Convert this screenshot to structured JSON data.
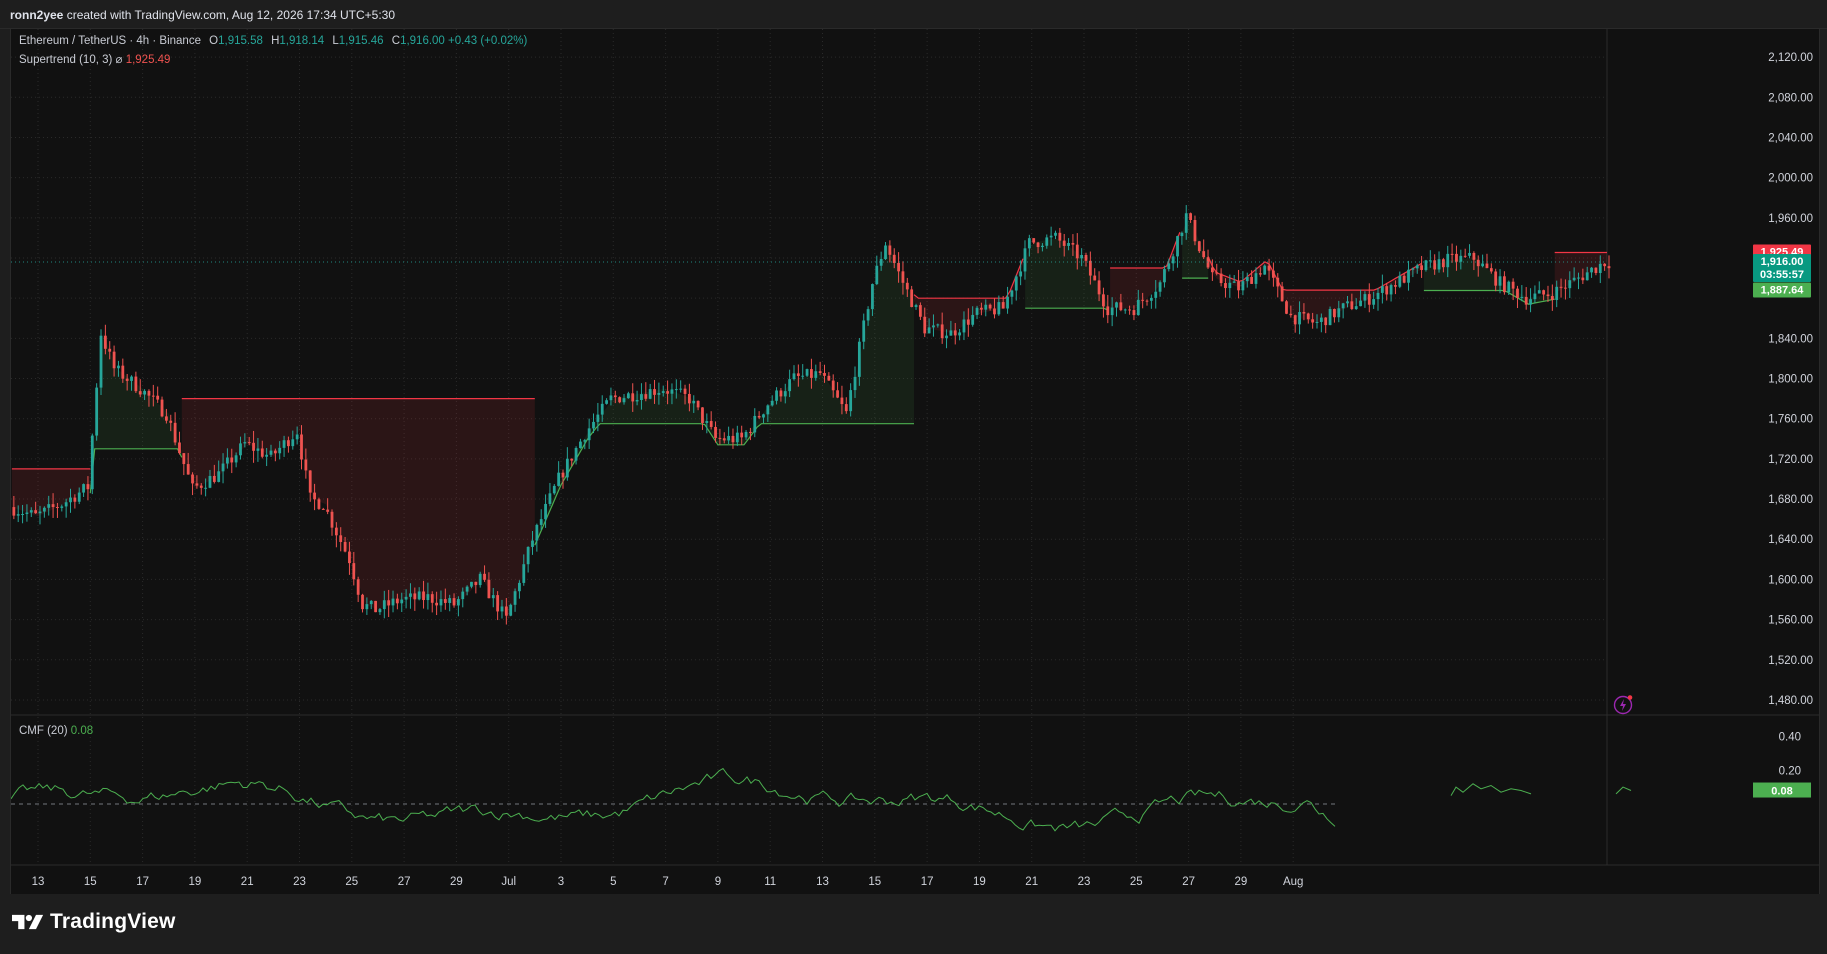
{
  "header": {
    "author": "ronn2yee",
    "created_text": "created with TradingView.com, Aug 12, 2026 17:34 UTC+5:30"
  },
  "legend": {
    "symbol": "Ethereum / TetherUS · 4h · Binance",
    "open_label": "O",
    "open": "1,915.58",
    "high_label": "H",
    "high": "1,918.14",
    "low_label": "L",
    "low": "1,915.46",
    "close_label": "C",
    "close": "1,916.00",
    "change": "+0.43 (+0.02%)",
    "supertrend_label": "Supertrend (10, 3)",
    "supertrend_symbol": "⌀",
    "supertrend_value": "1,925.49",
    "cmf_label": "CMF (20)",
    "cmf_value": "0.08"
  },
  "price_tags": {
    "supertrend": "1,925.49",
    "last_price": "1,916.00",
    "countdown": "03:55:57",
    "support": "1,887.64",
    "cmf": "0.08"
  },
  "colors": {
    "up": "#26a69a",
    "down": "#ef5350",
    "supertrend_up": "#4caf50",
    "supertrend_down": "#f23645",
    "cmf_line": "#4caf50",
    "background": "#111111"
  },
  "chart_data": {
    "type": "candlestick",
    "symbol": "ETHUSDT",
    "timeframe": "4h",
    "price_axis": {
      "ticks": [
        1480,
        1520,
        1560,
        1600,
        1640,
        1680,
        1720,
        1760,
        1800,
        1840,
        1880,
        1920,
        1960,
        2000,
        2040,
        2080,
        2120
      ],
      "tick_labels": [
        "1,480.00",
        "1,520.00",
        "1,560.00",
        "1,600.00",
        "1,640.00",
        "1,680.00",
        "1,720.00",
        "1,760.00",
        "1,800.00",
        "1,840.00",
        "",
        "",
        "1,960.00",
        "2,000.00",
        "2,040.00",
        "2,080.00",
        "2,120.00"
      ],
      "range": [
        1466,
        2148
      ]
    },
    "time_axis": {
      "labels": [
        "13",
        "15",
        "17",
        "19",
        "21",
        "23",
        "25",
        "27",
        "29",
        "Jul",
        "3",
        "5",
        "7",
        "9",
        "11",
        "13",
        "15",
        "17",
        "19",
        "21",
        "23",
        "25",
        "27",
        "29",
        "Aug"
      ]
    },
    "price_keypoints": [
      [
        "Jun 12",
        1672
      ],
      [
        "Jun 13",
        1663
      ],
      [
        "Jun 14",
        1675
      ],
      [
        "Jun 15",
        1692
      ],
      [
        "Jun 15 12:00",
        1845
      ],
      [
        "Jun 16",
        1810
      ],
      [
        "Jun 17",
        1790
      ],
      [
        "Jun 18",
        1765
      ],
      [
        "Jun 19",
        1690
      ],
      [
        "Jun 20",
        1705
      ],
      [
        "Jun 21",
        1735
      ],
      [
        "Jun 22",
        1722
      ],
      [
        "Jun 23",
        1748
      ],
      [
        "Jun 23 12:00",
        1680
      ],
      [
        "Jun 24",
        1675
      ],
      [
        "Jun 25",
        1620
      ],
      [
        "Jun 25 12:00",
        1575
      ],
      [
        "Jun 26",
        1570
      ],
      [
        "Jun 27",
        1580
      ],
      [
        "Jun 28",
        1582
      ],
      [
        "Jun 29",
        1575
      ],
      [
        "Jun 30",
        1600
      ],
      [
        "Jul 1",
        1560
      ],
      [
        "Jul 2",
        1640
      ],
      [
        "Jul 3",
        1700
      ],
      [
        "Jul 4",
        1745
      ],
      [
        "Jul 5",
        1780
      ],
      [
        "Jul 6",
        1785
      ],
      [
        "Jul 7",
        1790
      ],
      [
        "Jul 8",
        1780
      ],
      [
        "Jul 9",
        1740
      ],
      [
        "Jul 10",
        1740
      ],
      [
        "Jul 11",
        1775
      ],
      [
        "Jul 12",
        1800
      ],
      [
        "Jul 13",
        1805
      ],
      [
        "Jul 14",
        1765
      ],
      [
        "Jul 15",
        1895
      ],
      [
        "Jul 15 12:00",
        1935
      ],
      [
        "Jul 16",
        1905
      ],
      [
        "Jul 17",
        1850
      ],
      [
        "Jul 18",
        1845
      ],
      [
        "Jul 19",
        1865
      ],
      [
        "Jul 20",
        1870
      ],
      [
        "Jul 21",
        1935
      ],
      [
        "Jul 22",
        1940
      ],
      [
        "Jul 23",
        1920
      ],
      [
        "Jul 24",
        1870
      ],
      [
        "Jul 25",
        1870
      ],
      [
        "Jul 26",
        1895
      ],
      [
        "Jul 27",
        1962
      ],
      [
        "Jul 28",
        1900
      ],
      [
        "Jul 29",
        1890
      ],
      [
        "Jul 30",
        1912
      ],
      [
        "Jul 31",
        1862
      ],
      [
        "Aug 1",
        1855
      ],
      [
        "Aug 2",
        1870
      ],
      [
        "Aug 3",
        1880
      ],
      [
        "Aug 4",
        1895
      ],
      [
        "Aug 5",
        1910
      ],
      [
        "Aug 6",
        1918
      ],
      [
        "Aug 7",
        1920
      ],
      [
        "Aug 8",
        1895
      ],
      [
        "Aug 9",
        1880
      ],
      [
        "Aug 10",
        1885
      ],
      [
        "Aug 11",
        1900
      ],
      [
        "Aug 12",
        1916
      ]
    ],
    "supertrend": {
      "params": "10, 3",
      "current_value": 1925.49,
      "segments": [
        {
          "dir": "down",
          "from": "Jun 12",
          "to": "Jun 15",
          "level": 1710
        },
        {
          "dir": "up",
          "from": "Jun 15",
          "to": "Jun 18 12:00",
          "level": 1730
        },
        {
          "dir": "down",
          "from": "Jun 18 12:00",
          "to": "Jul 2",
          "level": 1780
        },
        {
          "dir": "up",
          "from": "Jul 2",
          "to": "Jul 16 12:00",
          "level": 1755
        },
        {
          "dir": "down",
          "from": "Jul 16 12:00",
          "to": "Jul 20 18:00",
          "level": 1880
        },
        {
          "dir": "up",
          "from": "Jul 20 18:00",
          "to": "Jul 24",
          "level": 1870
        },
        {
          "dir": "down",
          "from": "Jul 24",
          "to": "Jul 26 18:00",
          "level": 1910
        },
        {
          "dir": "up",
          "from": "Jul 26 18:00",
          "to": "Jul 27 18:00",
          "level": 1900
        },
        {
          "dir": "down",
          "from": "Jul 27 18:00",
          "to": "Aug 5",
          "level": 1888
        },
        {
          "dir": "up",
          "from": "Aug 5",
          "to": "Aug 10",
          "level": 1887.64
        },
        {
          "dir": "down",
          "from": "Aug 10",
          "to": "Aug 12",
          "level": 1925.49
        }
      ]
    },
    "cmf": {
      "period": 20,
      "value": 0.08,
      "axis_ticks": [
        0.2,
        0.4
      ],
      "axis_labels": [
        "0.20",
        "0.40"
      ],
      "zero_line": true
    },
    "grid": true
  }
}
